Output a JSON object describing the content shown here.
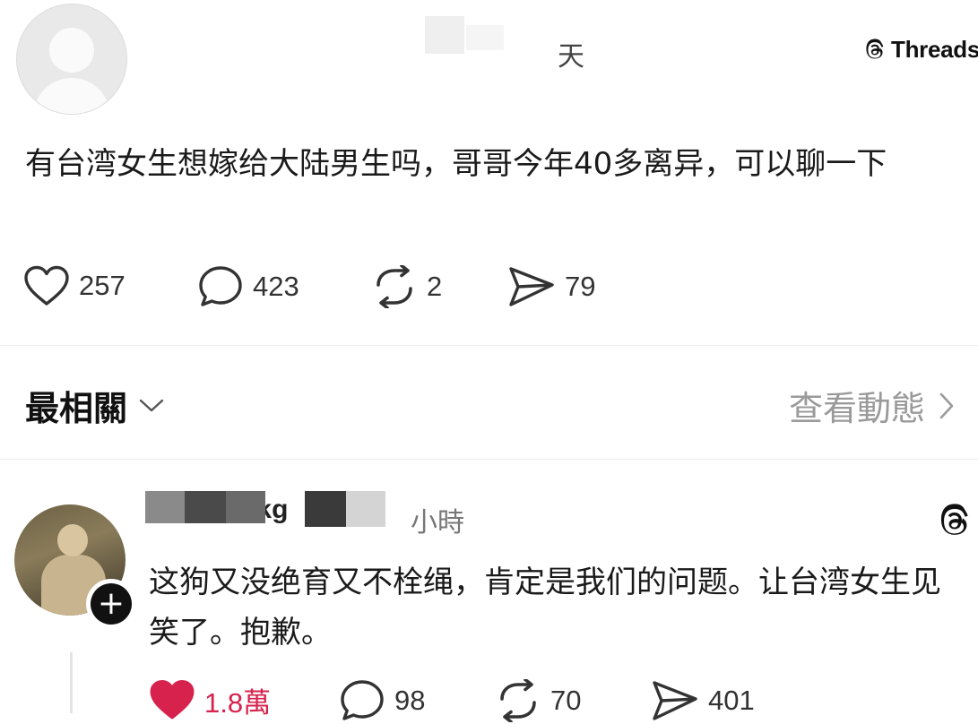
{
  "post": {
    "time_suffix": "天",
    "badge_label": "Threads",
    "text": "有台湾女生想嫁给大陆男生吗，哥哥今年40多离异，可以聊一下",
    "stats": {
      "likes": "257",
      "comments": "423",
      "reposts": "2",
      "shares": "79"
    }
  },
  "sort": {
    "label": "最相關",
    "activity_link": "查看動態"
  },
  "reply": {
    "username": "lovelsc_kg",
    "time": "小時",
    "text": "这狗又没绝育又不栓绳，肯定是我们的问题。让台湾女生见笑了。抱歉。",
    "liked": true,
    "stats": {
      "likes": "1.8萬",
      "comments": "98",
      "reposts": "70",
      "shares": "401"
    }
  },
  "icons": {
    "heart": "heart-icon",
    "comment": "comment-icon",
    "repost": "repost-icon",
    "share": "share-icon",
    "threads": "threads-logo-icon",
    "chevron_down": "chevron-down-icon",
    "chevron_right": "chevron-right-icon",
    "plus": "plus-icon"
  },
  "colors": {
    "like_active": "#d6224c",
    "muted_text": "#9a9a9a",
    "divider": "#ededed"
  }
}
